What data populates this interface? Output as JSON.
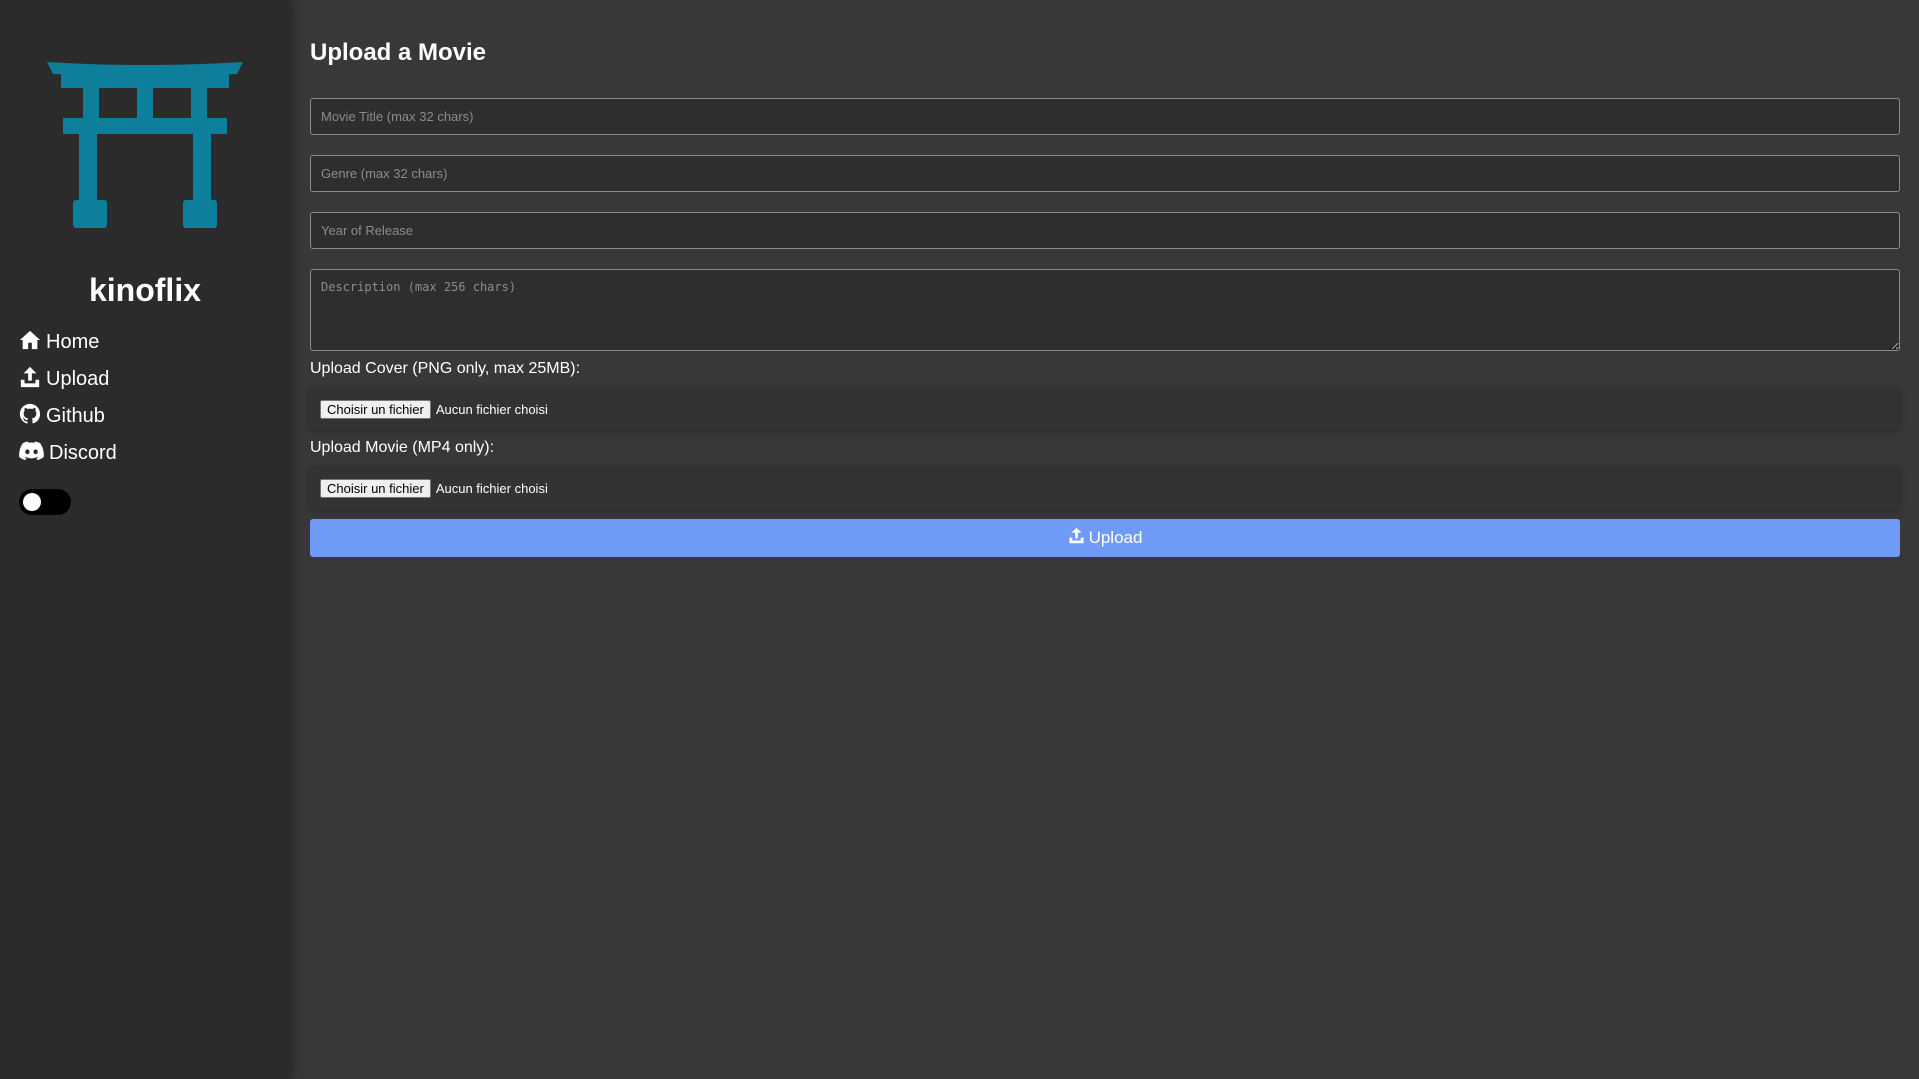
{
  "sidebar": {
    "brand": "kinoflix",
    "logo_color": "#0e7f9a",
    "nav": [
      {
        "label": "Home",
        "icon": "home-icon"
      },
      {
        "label": "Upload",
        "icon": "upload-icon"
      },
      {
        "label": "Github",
        "icon": "github-icon"
      },
      {
        "label": "Discord",
        "icon": "discord-icon"
      }
    ],
    "theme_toggle": {
      "on": false
    }
  },
  "form": {
    "title": "Upload a Movie",
    "movie_title_placeholder": "Movie Title (max 32 chars)",
    "genre_placeholder": "Genre (max 32 chars)",
    "year_placeholder": "Year of Release",
    "description_placeholder": "Description (max 256 chars)",
    "cover_label": "Upload Cover (PNG only, max 25MB):",
    "movie_label": "Upload Movie (MP4 only):",
    "file_button": "Choisir un fichier",
    "no_file": "Aucun fichier choisi",
    "submit_label": "Upload",
    "accent_color": "#6f9af6"
  }
}
